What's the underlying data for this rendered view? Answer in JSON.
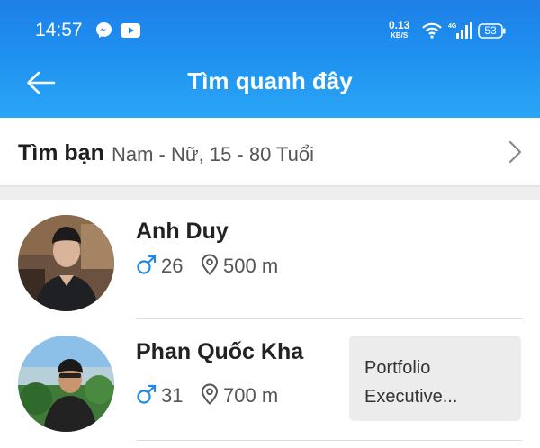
{
  "status_bar": {
    "time": "14:57",
    "speed_value": "0.13",
    "speed_unit": "KB/S",
    "battery": "53",
    "icons": [
      "messenger-icon",
      "youtube-icon",
      "wifi-icon",
      "signal-4g-icon",
      "battery-icon"
    ]
  },
  "header": {
    "title": "Tìm quanh đây",
    "back_icon": "back-arrow-icon"
  },
  "filter": {
    "label": "Tìm bạn",
    "value": "Nam - Nữ, 15 - 80 Tuổi",
    "chevron_icon": "chevron-right-icon"
  },
  "people": [
    {
      "name": "Anh Duy",
      "gender_icon": "male-icon",
      "age": "26",
      "distance": "500 m",
      "tag": ""
    },
    {
      "name": "Phan Quốc Kha",
      "gender_icon": "male-icon",
      "age": "31",
      "distance": "700 m",
      "tag_line1": "Portfolio",
      "tag_line2": "Executive..."
    }
  ],
  "colors": {
    "header_top": "#1f7fe6",
    "header_bottom": "#2aa6f5",
    "gender_male": "#1e88e5",
    "tag_bg": "#ececec"
  }
}
